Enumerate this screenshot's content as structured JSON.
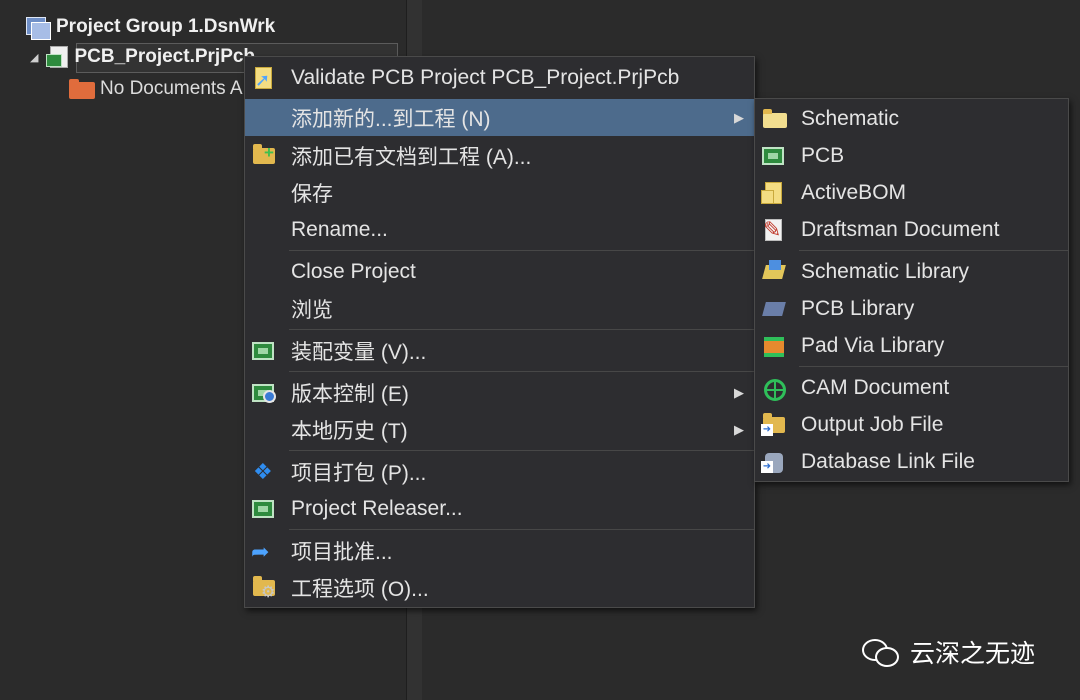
{
  "tree": {
    "group_label": "Project Group 1.DsnWrk",
    "project_label": "PCB_Project.PrjPcb",
    "nodocs_label": "No Documents A"
  },
  "main_menu": {
    "validate": "Validate PCB Project PCB_Project.PrjPcb",
    "add_new": "添加新的...到工程 (N)",
    "add_existing": "添加已有文档到工程 (A)...",
    "save": "保存",
    "rename": "Rename...",
    "close_project": "Close Project",
    "browse": "浏览",
    "variants": "装配变量 (V)...",
    "version_control": "版本控制 (E)",
    "local_history": "本地历史 (T)",
    "packager": "项目打包 (P)...",
    "releaser": "Project Releaser...",
    "approval": "项目批准...",
    "options": "工程选项 (O)..."
  },
  "sub_menu": {
    "schematic": "Schematic",
    "pcb": "PCB",
    "activebom": "ActiveBOM",
    "draftsman": "Draftsman Document",
    "schematic_library": "Schematic Library",
    "pcb_library": "PCB Library",
    "pad_via_library": "Pad Via Library",
    "cam_document": "CAM Document",
    "output_job": "Output Job File",
    "database_link": "Database Link File"
  },
  "watermark": {
    "text": "云深之无迹"
  },
  "colors": {
    "highlight": "#4d6b8c",
    "menu_bg": "#2d2d30",
    "panel_bg": "#2b2b2b"
  }
}
